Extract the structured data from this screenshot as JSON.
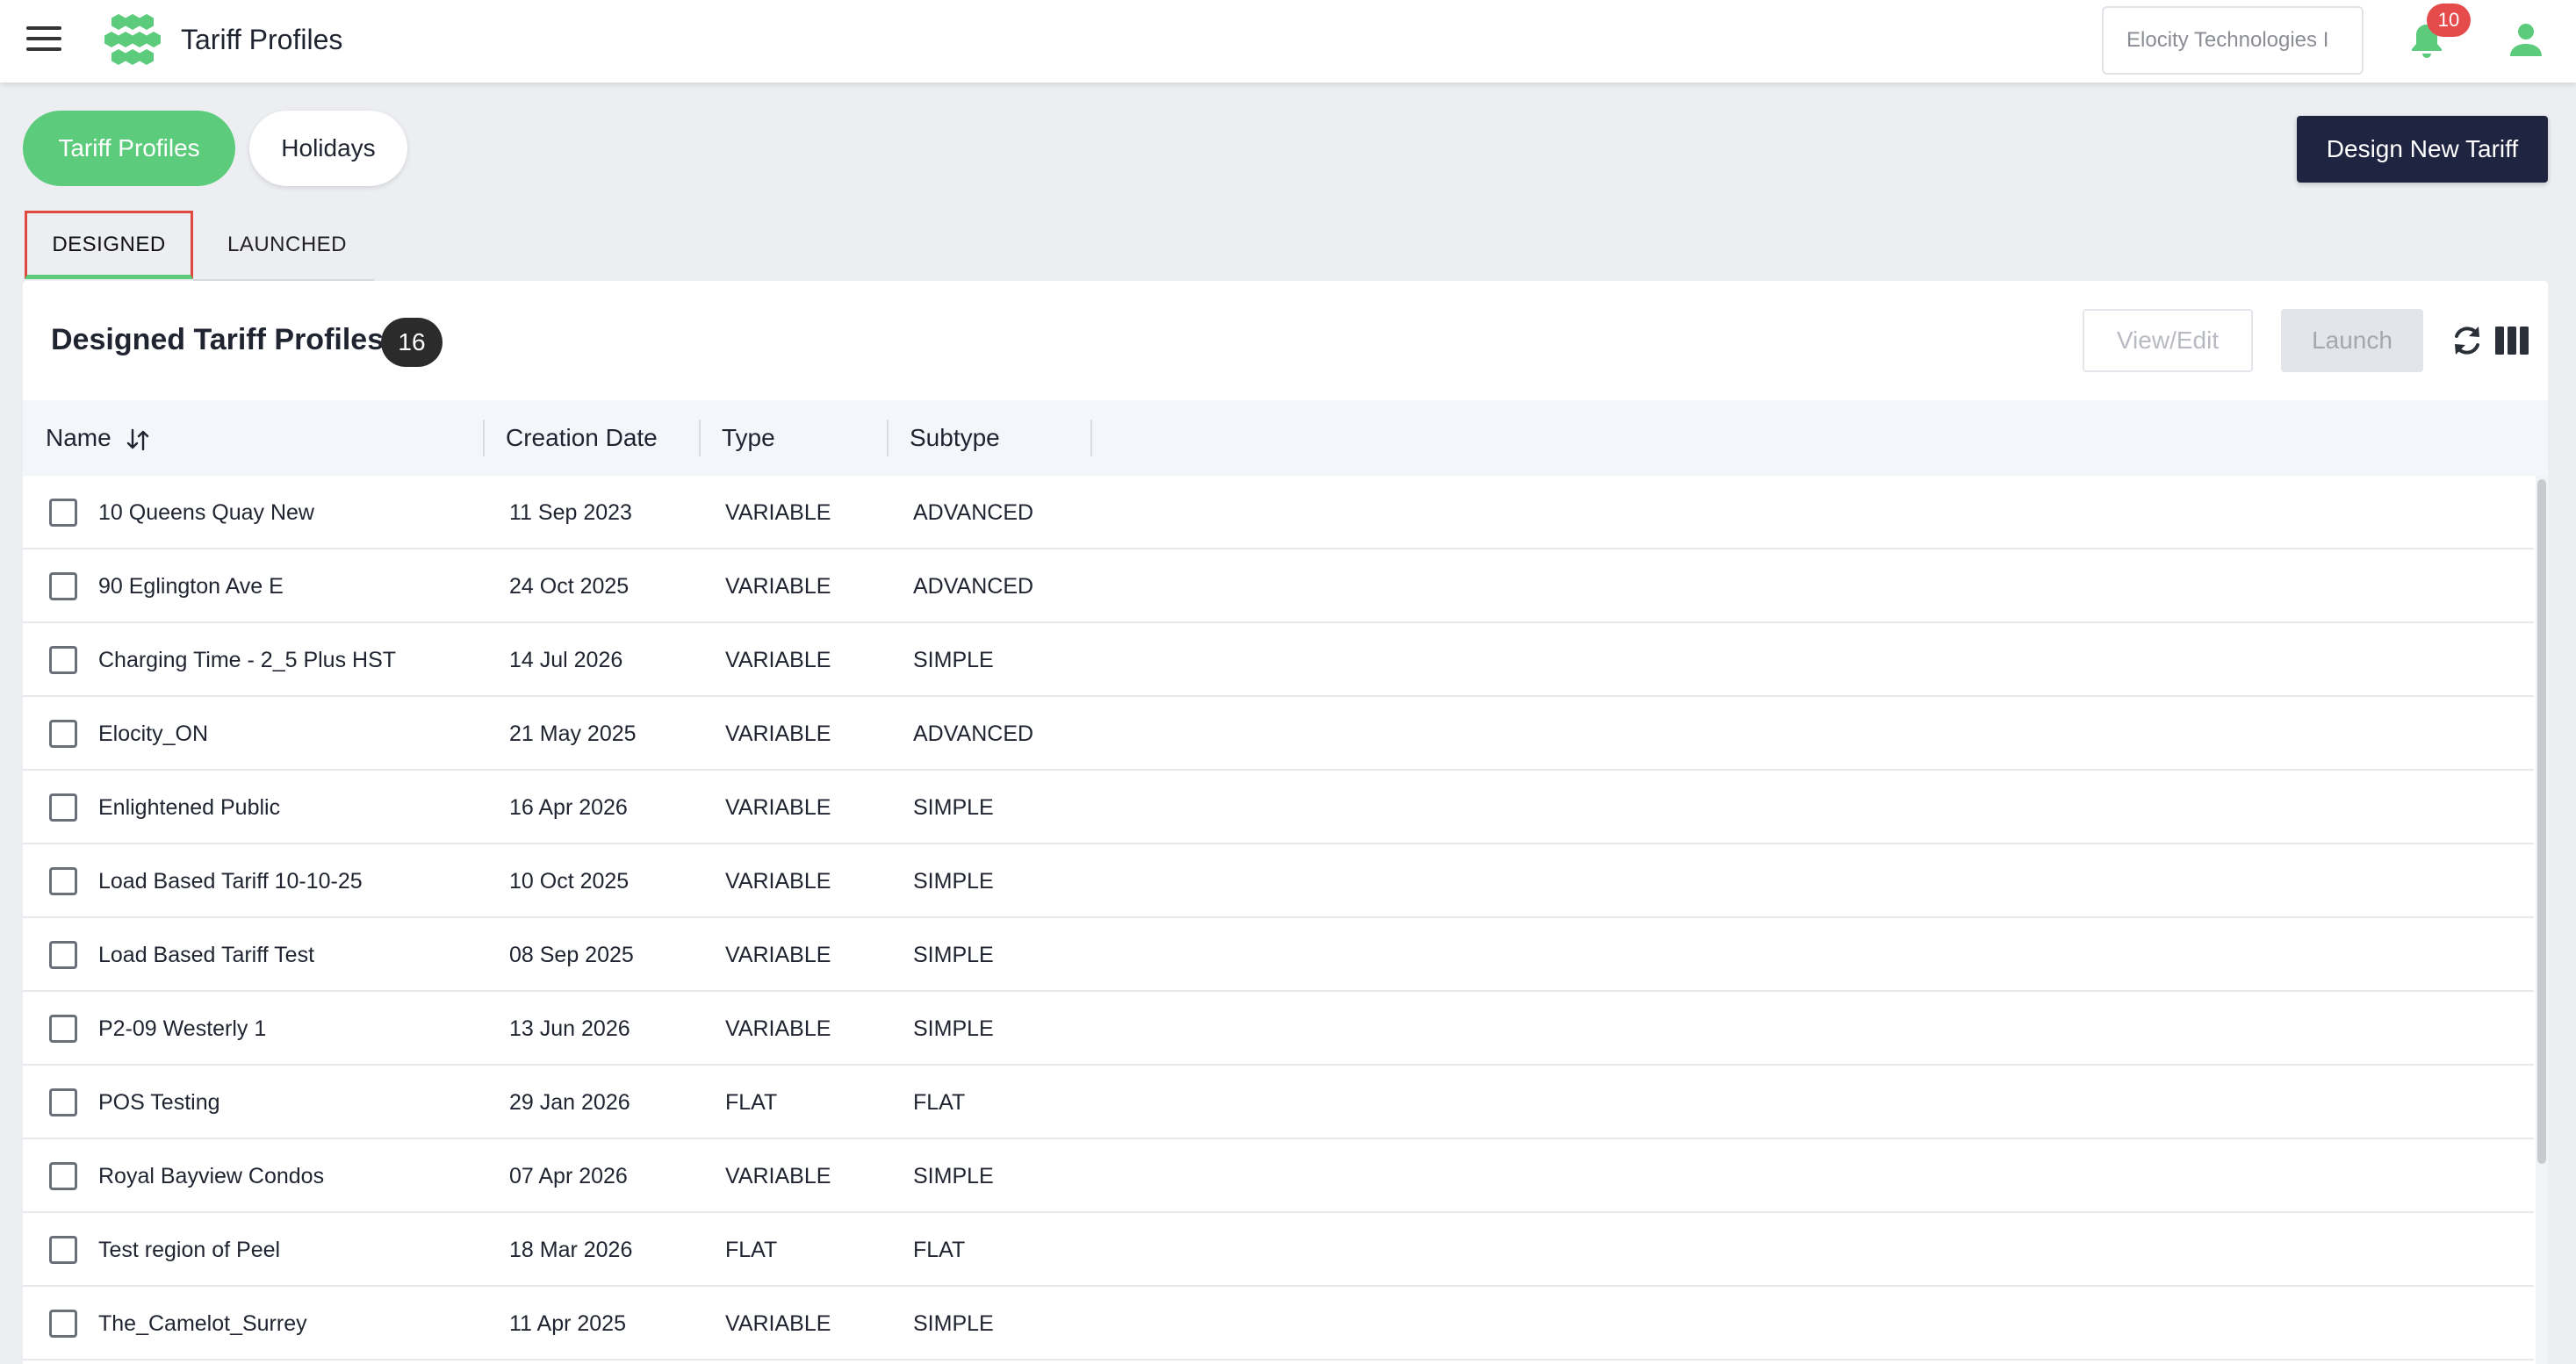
{
  "header": {
    "title": "Tariff Profiles",
    "org_selector": "Elocity Technologies I",
    "notification_count": "10",
    "brand_color": "#5ccc7c"
  },
  "pills": {
    "tariff_profiles": "Tariff Profiles",
    "holidays": "Holidays"
  },
  "design_new_tariff": "Design New Tariff",
  "tabs": {
    "designed": "DESIGNED",
    "launched": "LAUNCHED"
  },
  "panel": {
    "title": "Designed Tariff Profiles",
    "count": "16",
    "view_edit": "View/Edit",
    "launch": "Launch"
  },
  "table": {
    "columns": {
      "name": "Name",
      "creation_date": "Creation Date",
      "type": "Type",
      "subtype": "Subtype"
    },
    "rows": [
      {
        "name": "10 Queens Quay New",
        "date": "11 Sep 2023",
        "type": "VARIABLE",
        "subtype": "ADVANCED"
      },
      {
        "name": "90 Eglington Ave E",
        "date": "24 Oct 2025",
        "type": "VARIABLE",
        "subtype": "ADVANCED"
      },
      {
        "name": "Charging Time - 2_5 Plus HST",
        "date": "14 Jul 2026",
        "type": "VARIABLE",
        "subtype": "SIMPLE"
      },
      {
        "name": "Elocity_ON",
        "date": "21 May 2025",
        "type": "VARIABLE",
        "subtype": "ADVANCED"
      },
      {
        "name": "Enlightened Public",
        "date": "16 Apr 2026",
        "type": "VARIABLE",
        "subtype": "SIMPLE"
      },
      {
        "name": "Load Based Tariff 10-10-25",
        "date": "10 Oct 2025",
        "type": "VARIABLE",
        "subtype": "SIMPLE"
      },
      {
        "name": "Load Based Tariff Test",
        "date": "08 Sep 2025",
        "type": "VARIABLE",
        "subtype": "SIMPLE"
      },
      {
        "name": "P2-09 Westerly 1",
        "date": "13 Jun 2026",
        "type": "VARIABLE",
        "subtype": "SIMPLE"
      },
      {
        "name": "POS Testing",
        "date": "29 Jan 2026",
        "type": "FLAT",
        "subtype": "FLAT"
      },
      {
        "name": "Royal Bayview Condos",
        "date": "07 Apr 2026",
        "type": "VARIABLE",
        "subtype": "SIMPLE"
      },
      {
        "name": "Test region of Peel",
        "date": "18 Mar 2026",
        "type": "FLAT",
        "subtype": "FLAT"
      },
      {
        "name": "The_Camelot_Surrey",
        "date": "11 Apr 2025",
        "type": "VARIABLE",
        "subtype": "SIMPLE"
      }
    ]
  },
  "icons": {
    "menu": "hamburger-menu-icon",
    "logo": "hexagon-cluster-logo",
    "bell": "bell-icon",
    "user": "user-icon",
    "sort": "sort-arrows-icon",
    "refresh": "refresh-icon",
    "columns": "columns-icon"
  }
}
